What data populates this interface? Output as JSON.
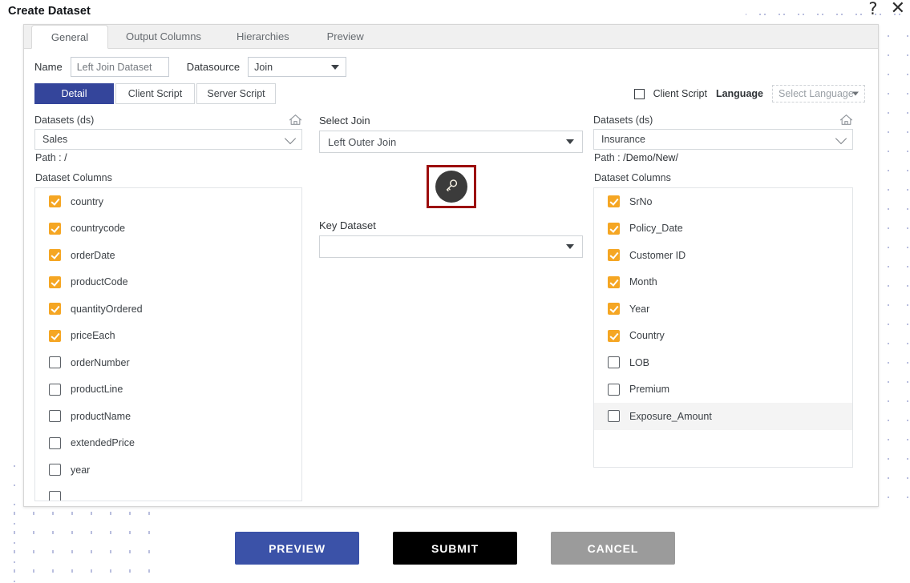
{
  "window": {
    "title": "Create Dataset",
    "help_icon": "?",
    "close_icon": "✕"
  },
  "tabs": [
    {
      "label": "General",
      "active": true
    },
    {
      "label": "Output Columns",
      "active": false
    },
    {
      "label": "Hierarchies",
      "active": false
    },
    {
      "label": "Preview",
      "active": false
    }
  ],
  "form": {
    "name_label": "Name",
    "name_value": "Left Join Dataset",
    "name_placeholder": "Left Join Dataset",
    "datasource_label": "Datasource",
    "datasource_value": "Join"
  },
  "inner_tabs": [
    {
      "label": "Detail",
      "active": true
    },
    {
      "label": "Client Script",
      "active": false
    },
    {
      "label": "Server Script",
      "active": false
    }
  ],
  "inner_right": {
    "client_script_label": "Client Script",
    "client_script_checked": false,
    "language_label": "Language",
    "language_value": "Select Language"
  },
  "left_panel": {
    "datasets_label": "Datasets (ds)",
    "home_icon": "home-icon",
    "dataset_value": "Sales",
    "path_label": "Path :",
    "path_value": "/",
    "columns_label": "Dataset Columns",
    "columns": [
      {
        "label": "country",
        "checked": true
      },
      {
        "label": "countrycode",
        "checked": true
      },
      {
        "label": "orderDate",
        "checked": true
      },
      {
        "label": "productCode",
        "checked": true
      },
      {
        "label": "quantityOrdered",
        "checked": true
      },
      {
        "label": "priceEach",
        "checked": true
      },
      {
        "label": "orderNumber",
        "checked": false
      },
      {
        "label": "productLine",
        "checked": false
      },
      {
        "label": "productName",
        "checked": false
      },
      {
        "label": "extendedPrice",
        "checked": false
      },
      {
        "label": "year",
        "checked": false
      },
      {
        "label": "",
        "checked": false
      }
    ]
  },
  "middle_panel": {
    "select_join_label": "Select Join",
    "select_join_value": "Left Outer Join",
    "key_button_icon": "key-icon",
    "key_dataset_label": "Key Dataset",
    "key_dataset_value": ""
  },
  "right_panel": {
    "datasets_label": "Datasets (ds)",
    "home_icon": "home-icon",
    "dataset_value": "Insurance",
    "path_label": "Path :",
    "path_value": "/Demo/New/",
    "columns_label": "Dataset Columns",
    "columns": [
      {
        "label": "SrNo",
        "checked": true,
        "highlighted": false
      },
      {
        "label": "Policy_Date",
        "checked": true,
        "highlighted": false
      },
      {
        "label": "Customer ID",
        "checked": true,
        "highlighted": false
      },
      {
        "label": "Month",
        "checked": true,
        "highlighted": false
      },
      {
        "label": "Year",
        "checked": true,
        "highlighted": false
      },
      {
        "label": "Country",
        "checked": true,
        "highlighted": false
      },
      {
        "label": "LOB",
        "checked": false,
        "highlighted": false
      },
      {
        "label": "Premium",
        "checked": false,
        "highlighted": false
      },
      {
        "label": "Exposure_Amount",
        "checked": false,
        "highlighted": true
      }
    ]
  },
  "footer": {
    "preview_label": "PREVIEW",
    "submit_label": "SUBMIT",
    "cancel_label": "CANCEL"
  },
  "colors": {
    "accent_blue": "#34459b",
    "preview_blue": "#3b52a8",
    "submit_black": "#000000",
    "cancel_gray": "#9b9b9b",
    "checkbox_orange": "#f5a623",
    "highlight_red": "#9c0d0d",
    "dot_pattern": "#b9bede"
  }
}
